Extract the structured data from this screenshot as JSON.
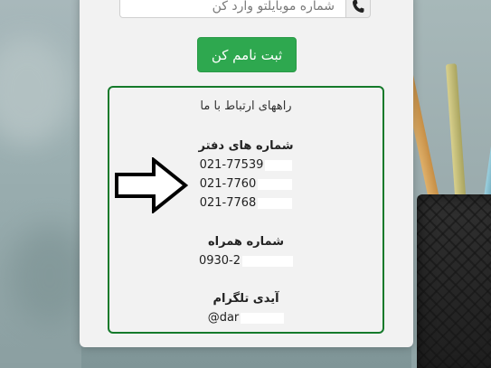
{
  "phone": {
    "placeholder": "شماره موبایلتو وارد کن",
    "icon": "phone-icon"
  },
  "submit_button": {
    "label": "ثبت نامم کن",
    "color": "#2ea84f"
  },
  "contact": {
    "title": "راههای ارتباط با ما",
    "office_heading": "شماره های دفتر",
    "office_numbers": [
      "021-77539",
      "021-7760",
      "021-7768"
    ],
    "mobile_heading": "شماره همراه",
    "mobile_number": "0930-2",
    "telegram_heading": "آیدی تلگرام",
    "telegram_id": "@dar",
    "border_color": "#157a2b"
  },
  "annotation": {
    "icon": "right-arrow-icon"
  }
}
